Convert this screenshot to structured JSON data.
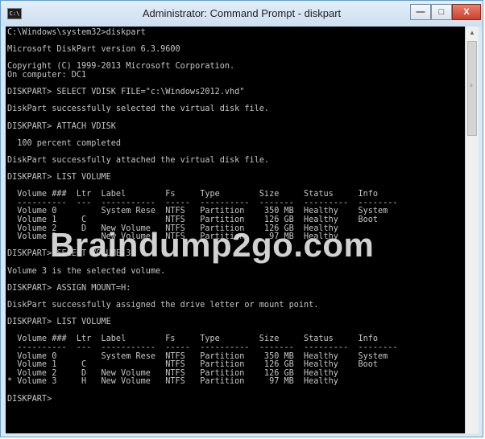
{
  "window": {
    "title": "Administrator: Command Prompt - diskpart",
    "minimize_label": "—",
    "maximize_label": "□",
    "close_label": "X",
    "icon_text": "C:\\"
  },
  "scrollbar": {
    "up_arrow": "▲",
    "grip": "≡"
  },
  "console": {
    "lines": [
      "C:\\Windows\\system32>diskpart",
      "",
      "Microsoft DiskPart version 6.3.9600",
      "",
      "Copyright (C) 1999-2013 Microsoft Corporation.",
      "On computer: DC1",
      "",
      "DISKPART> SELECT VDISK FILE=\"c:\\Windows2012.vhd\"",
      "",
      "DiskPart successfully selected the virtual disk file.",
      "",
      "DISKPART> ATTACH VDISK",
      "",
      "  100 percent completed",
      "",
      "DiskPart successfully attached the virtual disk file.",
      "",
      "DISKPART> LIST VOLUME",
      "",
      "  Volume ###  Ltr  Label        Fs     Type        Size     Status     Info",
      "  ----------  ---  -----------  -----  ----------  -------  ---------  --------",
      "  Volume 0         System Rese  NTFS   Partition    350 MB  Healthy    System",
      "  Volume 1     C                NTFS   Partition    126 GB  Healthy    Boot",
      "  Volume 2     D   New Volume   NTFS   Partition    126 GB  Healthy",
      "  Volume 3         New Volume   NTFS   Partition     97 MB  Healthy",
      "",
      "DISKPART> SELECT VOLUME 3",
      "",
      "Volume 3 is the selected volume.",
      "",
      "DISKPART> ASSIGN MOUNT=H:",
      "",
      "DiskPart successfully assigned the drive letter or mount point.",
      "",
      "DISKPART> LIST VOLUME",
      "",
      "  Volume ###  Ltr  Label        Fs     Type        Size     Status     Info",
      "  ----------  ---  -----------  -----  ----------  -------  ---------  --------",
      "  Volume 0         System Rese  NTFS   Partition    350 MB  Healthy    System",
      "  Volume 1     C                NTFS   Partition    126 GB  Healthy    Boot",
      "  Volume 2     D   New Volume   NTFS   Partition    126 GB  Healthy",
      "* Volume 3     H   New Volume   NTFS   Partition     97 MB  Healthy",
      "",
      "DISKPART>"
    ]
  },
  "watermark": {
    "text": "Braindump2go.com"
  }
}
